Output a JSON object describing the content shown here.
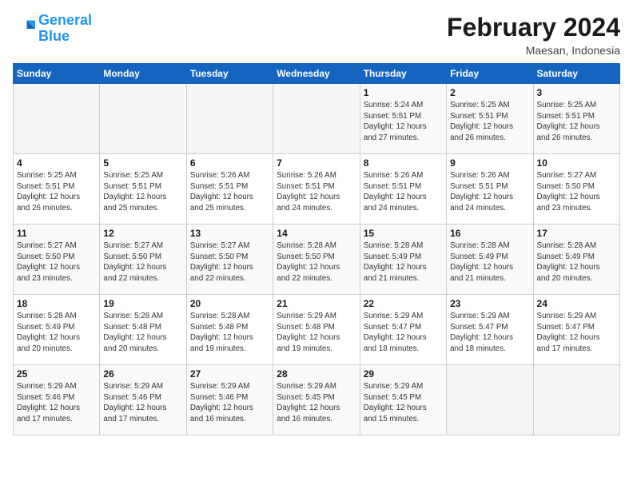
{
  "header": {
    "logo_line1": "General",
    "logo_line2": "Blue",
    "month": "February 2024",
    "location": "Maesan, Indonesia"
  },
  "weekdays": [
    "Sunday",
    "Monday",
    "Tuesday",
    "Wednesday",
    "Thursday",
    "Friday",
    "Saturday"
  ],
  "weeks": [
    [
      {
        "day": "",
        "info": ""
      },
      {
        "day": "",
        "info": ""
      },
      {
        "day": "",
        "info": ""
      },
      {
        "day": "",
        "info": ""
      },
      {
        "day": "1",
        "info": "Sunrise: 5:24 AM\nSunset: 5:51 PM\nDaylight: 12 hours\nand 27 minutes."
      },
      {
        "day": "2",
        "info": "Sunrise: 5:25 AM\nSunset: 5:51 PM\nDaylight: 12 hours\nand 26 minutes."
      },
      {
        "day": "3",
        "info": "Sunrise: 5:25 AM\nSunset: 5:51 PM\nDaylight: 12 hours\nand 26 minutes."
      }
    ],
    [
      {
        "day": "4",
        "info": "Sunrise: 5:25 AM\nSunset: 5:51 PM\nDaylight: 12 hours\nand 26 minutes."
      },
      {
        "day": "5",
        "info": "Sunrise: 5:25 AM\nSunset: 5:51 PM\nDaylight: 12 hours\nand 25 minutes."
      },
      {
        "day": "6",
        "info": "Sunrise: 5:26 AM\nSunset: 5:51 PM\nDaylight: 12 hours\nand 25 minutes."
      },
      {
        "day": "7",
        "info": "Sunrise: 5:26 AM\nSunset: 5:51 PM\nDaylight: 12 hours\nand 24 minutes."
      },
      {
        "day": "8",
        "info": "Sunrise: 5:26 AM\nSunset: 5:51 PM\nDaylight: 12 hours\nand 24 minutes."
      },
      {
        "day": "9",
        "info": "Sunrise: 5:26 AM\nSunset: 5:51 PM\nDaylight: 12 hours\nand 24 minutes."
      },
      {
        "day": "10",
        "info": "Sunrise: 5:27 AM\nSunset: 5:50 PM\nDaylight: 12 hours\nand 23 minutes."
      }
    ],
    [
      {
        "day": "11",
        "info": "Sunrise: 5:27 AM\nSunset: 5:50 PM\nDaylight: 12 hours\nand 23 minutes."
      },
      {
        "day": "12",
        "info": "Sunrise: 5:27 AM\nSunset: 5:50 PM\nDaylight: 12 hours\nand 22 minutes."
      },
      {
        "day": "13",
        "info": "Sunrise: 5:27 AM\nSunset: 5:50 PM\nDaylight: 12 hours\nand 22 minutes."
      },
      {
        "day": "14",
        "info": "Sunrise: 5:28 AM\nSunset: 5:50 PM\nDaylight: 12 hours\nand 22 minutes."
      },
      {
        "day": "15",
        "info": "Sunrise: 5:28 AM\nSunset: 5:49 PM\nDaylight: 12 hours\nand 21 minutes."
      },
      {
        "day": "16",
        "info": "Sunrise: 5:28 AM\nSunset: 5:49 PM\nDaylight: 12 hours\nand 21 minutes."
      },
      {
        "day": "17",
        "info": "Sunrise: 5:28 AM\nSunset: 5:49 PM\nDaylight: 12 hours\nand 20 minutes."
      }
    ],
    [
      {
        "day": "18",
        "info": "Sunrise: 5:28 AM\nSunset: 5:49 PM\nDaylight: 12 hours\nand 20 minutes."
      },
      {
        "day": "19",
        "info": "Sunrise: 5:28 AM\nSunset: 5:48 PM\nDaylight: 12 hours\nand 20 minutes."
      },
      {
        "day": "20",
        "info": "Sunrise: 5:28 AM\nSunset: 5:48 PM\nDaylight: 12 hours\nand 19 minutes."
      },
      {
        "day": "21",
        "info": "Sunrise: 5:29 AM\nSunset: 5:48 PM\nDaylight: 12 hours\nand 19 minutes."
      },
      {
        "day": "22",
        "info": "Sunrise: 5:29 AM\nSunset: 5:47 PM\nDaylight: 12 hours\nand 18 minutes."
      },
      {
        "day": "23",
        "info": "Sunrise: 5:29 AM\nSunset: 5:47 PM\nDaylight: 12 hours\nand 18 minutes."
      },
      {
        "day": "24",
        "info": "Sunrise: 5:29 AM\nSunset: 5:47 PM\nDaylight: 12 hours\nand 17 minutes."
      }
    ],
    [
      {
        "day": "25",
        "info": "Sunrise: 5:29 AM\nSunset: 5:46 PM\nDaylight: 12 hours\nand 17 minutes."
      },
      {
        "day": "26",
        "info": "Sunrise: 5:29 AM\nSunset: 5:46 PM\nDaylight: 12 hours\nand 17 minutes."
      },
      {
        "day": "27",
        "info": "Sunrise: 5:29 AM\nSunset: 5:46 PM\nDaylight: 12 hours\nand 16 minutes."
      },
      {
        "day": "28",
        "info": "Sunrise: 5:29 AM\nSunset: 5:45 PM\nDaylight: 12 hours\nand 16 minutes."
      },
      {
        "day": "29",
        "info": "Sunrise: 5:29 AM\nSunset: 5:45 PM\nDaylight: 12 hours\nand 15 minutes."
      },
      {
        "day": "",
        "info": ""
      },
      {
        "day": "",
        "info": ""
      }
    ]
  ]
}
